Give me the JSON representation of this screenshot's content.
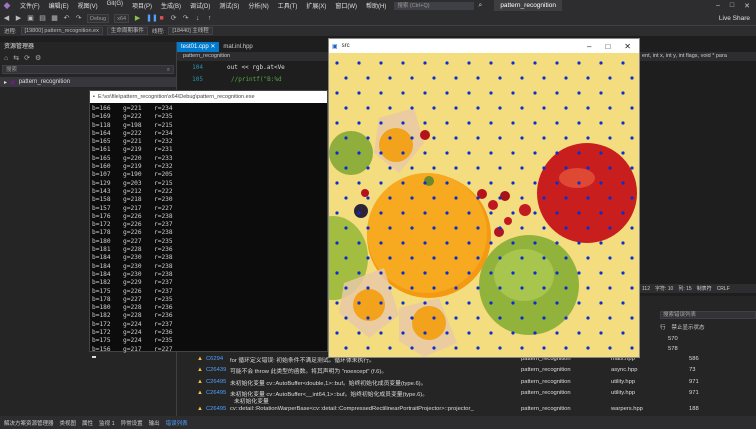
{
  "titlebar": {
    "menus": [
      "文件(F)",
      "编辑(E)",
      "视图(V)",
      "Git(G)",
      "项目(P)",
      "生成(B)",
      "调试(D)",
      "测试(S)",
      "分析(N)",
      "工具(T)",
      "扩展(X)",
      "窗口(W)",
      "帮助(H)"
    ],
    "search_placeholder": "搜索 (Ctrl+Q)",
    "app_title": "pattern_recognition",
    "live_share": "Live Share"
  },
  "toolbar": {
    "config": "Debug",
    "platform": "x64"
  },
  "procbar": {
    "process_label": "进程:",
    "process_value": "[19800] pattern_recognition.ex",
    "lifecycle": "生命周期事件",
    "thread_label": "线程:",
    "thread_value": "[18440] 主线程"
  },
  "solution_panel": {
    "title": "资源管理器",
    "search_placeholder": "搜索",
    "root_item": "pattern_recognition"
  },
  "editor": {
    "tabs": [
      "test01.cpp",
      "mat.inl.hpp"
    ],
    "nav": "pattern_recognition",
    "lines": [
      {
        "num": "104",
        "text": "out << rgb.at<Ve"
      },
      {
        "num": "105",
        "text": "//printf(\"B:%d"
      }
    ]
  },
  "right_editor": {
    "nav": "ent, int x, int y, int flags, void * para",
    "status": [
      "112",
      "字符: 10",
      "列: 15",
      "制表符",
      "CRLF"
    ]
  },
  "console": {
    "title": "E:\\vs\\file\\pattern_recognition\\x64\\Debug\\pattern_recognition.exe",
    "rows": [
      [
        "b=166",
        "g=221",
        "r=234"
      ],
      [
        "b=169",
        "g=222",
        "r=235"
      ],
      [
        "b=118",
        "g=198",
        "r=215"
      ],
      [
        "b=164",
        "g=222",
        "r=234"
      ],
      [
        "b=165",
        "g=221",
        "r=232"
      ],
      [
        "b=161",
        "g=219",
        "r=231"
      ],
      [
        "b=165",
        "g=220",
        "r=233"
      ],
      [
        "b=160",
        "g=219",
        "r=232"
      ],
      [
        "b=107",
        "g=190",
        "r=205"
      ],
      [
        "b=129",
        "g=203",
        "r=215"
      ],
      [
        "b=143",
        "g=212",
        "r=222"
      ],
      [
        "b=158",
        "g=218",
        "r=230"
      ],
      [
        "b=157",
        "g=217",
        "r=227"
      ],
      [
        "b=176",
        "g=226",
        "r=238"
      ],
      [
        "b=172",
        "g=226",
        "r=237"
      ],
      [
        "b=178",
        "g=226",
        "r=238"
      ],
      [
        "b=180",
        "g=227",
        "r=235"
      ],
      [
        "b=181",
        "g=228",
        "r=236"
      ],
      [
        "b=184",
        "g=230",
        "r=238"
      ],
      [
        "b=184",
        "g=230",
        "r=238"
      ],
      [
        "b=184",
        "g=230",
        "r=238"
      ],
      [
        "b=182",
        "g=229",
        "r=237"
      ],
      [
        "b=175",
        "g=226",
        "r=237"
      ],
      [
        "b=178",
        "g=227",
        "r=235"
      ],
      [
        "b=180",
        "g=228",
        "r=236"
      ],
      [
        "b=182",
        "g=228",
        "r=236"
      ],
      [
        "b=172",
        "g=224",
        "r=237"
      ],
      [
        "b=172",
        "g=224",
        "r=236"
      ],
      [
        "b=175",
        "g=224",
        "r=235"
      ],
      [
        "b=156",
        "g=217",
        "r=227"
      ]
    ]
  },
  "src_window": {
    "title": "src"
  },
  "error_list": {
    "search_placeholder": "搜索错误列表",
    "col_line": "行",
    "col_state": "禁止显示状态",
    "top_lines": [
      "570",
      "578"
    ],
    "rows": [
      {
        "code": "C6294",
        "desc": "for 循环定义错误: 初始条件不满足测试。循环体未执行。",
        "proj": "pattern_recognition",
        "file": "matx.hpp",
        "line": "586"
      },
      {
        "code": "C26439",
        "desc": "可能不会 throw 此类型的函数。将其声明为 \"noexcept\" (f.6)。",
        "proj": "pattern_recognition",
        "file": "async.hpp",
        "line": "73"
      },
      {
        "code": "C26495",
        "desc": "未初始化变量 cv::AutoBuffer<double,1>::buf。始终初始化成员变量(type.6)。",
        "proj": "pattern_recognition",
        "file": "utility.hpp",
        "line": "971"
      },
      {
        "code": "C26495",
        "desc": "未初始化变量 cv::AutoBuffer<__int64,1>::buf。始终初始化成员变量(type.6)。",
        "proj": "pattern_recognition",
        "file": "utility.hpp",
        "line": "971"
      },
      {
        "code": "C26495",
        "desc": "cv::detail::RotationWarperBase<cv::detail::CompressedRectilinearPortraitProjector>::projector_",
        "proj": "pattern_recognition",
        "file": "warpers.hpp",
        "line": "188"
      }
    ],
    "extra_line": "未初始化变量"
  },
  "statusbar": {
    "items": [
      "解决方案资源管理器",
      "类视图",
      "属性",
      "监视 1",
      "异常设置",
      "输出",
      "错误列表"
    ],
    "active_index": 6
  },
  "colors": {
    "accent": "#007acc",
    "marker_dot": "#0a2fd0",
    "background": "#f3dd7e"
  }
}
